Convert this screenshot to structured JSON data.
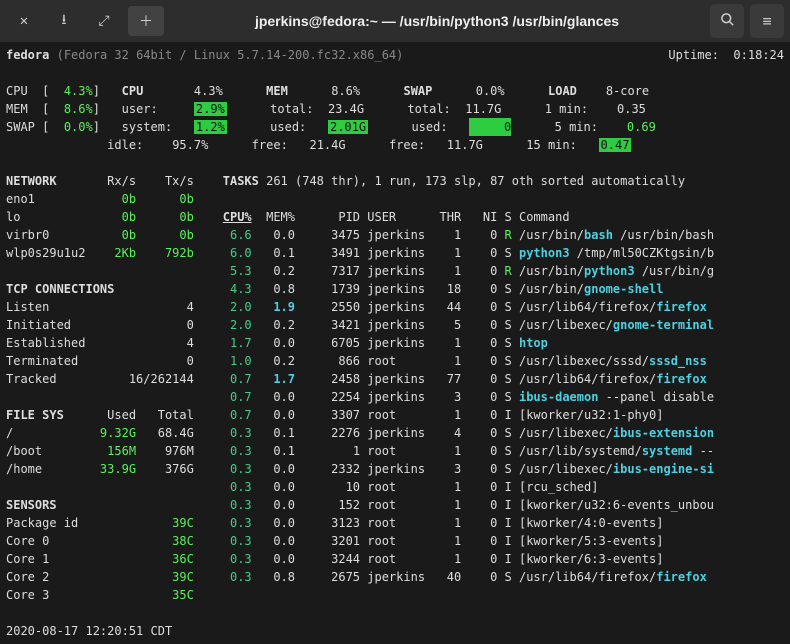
{
  "titlebar": {
    "title": "jperkins@fedora:~ — /usr/bin/python3 /usr/bin/glances"
  },
  "header": {
    "hostname": "fedora",
    "sysinfo": "(Fedora 32 64bit / Linux 5.7.14-200.fc32.x86_64)",
    "uptime_label": "Uptime:",
    "uptime": "0:18:24"
  },
  "summary": {
    "cpu_lbl": "CPU",
    "cpu_val": "4.3%",
    "mem_lbl": "MEM",
    "mem_val": "8.6%",
    "swap_lbl": "SWAP",
    "swap_val": "0.0%",
    "cpu2_lbl": "CPU",
    "cpu2_val": "4.3%",
    "user_lbl": "user:",
    "user_val": "2.9%",
    "system_lbl": "system:",
    "system_val": "1.2%",
    "idle_lbl": "idle:",
    "idle_val": "95.7%",
    "mem2_lbl": "MEM",
    "mem2_val": "8.6%",
    "total_lbl": "total:",
    "total_val": "23.4G",
    "used_lbl": "used:",
    "used_val": "2.01G",
    "free_lbl": "free:",
    "free_val": "21.4G",
    "swap2_lbl": "SWAP",
    "swap2_val": "0.0%",
    "swap_total_lbl": "total:",
    "swap_total_val": "11.7G",
    "swap_used_lbl": "used:",
    "swap_used_val": "0",
    "swap_free_lbl": "free:",
    "swap_free_val": "11.7G",
    "load_lbl": "LOAD",
    "load_val": "8-core",
    "load1_lbl": "1 min:",
    "load1_val": "0.35",
    "load5_lbl": "5 min:",
    "load5_val": "0.69",
    "load15_lbl": "15 min:",
    "load15_val": "0.47"
  },
  "network": {
    "title": "NETWORK",
    "col1": "Rx/s",
    "col2": "Tx/s",
    "rows": [
      {
        "n": "eno1",
        "r": "0b",
        "t": "0b"
      },
      {
        "n": "lo",
        "r": "0b",
        "t": "0b"
      },
      {
        "n": "virbr0",
        "r": "0b",
        "t": "0b"
      },
      {
        "n": "wlp0s29u1u2",
        "r": "2Kb",
        "t": "792b"
      }
    ]
  },
  "tcp": {
    "title": "TCP CONNECTIONS",
    "rows": [
      {
        "n": "Listen",
        "v": "4"
      },
      {
        "n": "Initiated",
        "v": "0"
      },
      {
        "n": "Established",
        "v": "4"
      },
      {
        "n": "Terminated",
        "v": "0"
      },
      {
        "n": "Tracked",
        "v": "16/262144"
      }
    ]
  },
  "fs": {
    "title": "FILE SYS",
    "col1": "Used",
    "col2": "Total",
    "rows": [
      {
        "n": "/",
        "u": "9.32G",
        "t": "68.4G",
        "uc": "green"
      },
      {
        "n": "/boot",
        "u": "156M",
        "t": "976M",
        "uc": "green"
      },
      {
        "n": "/home",
        "u": "33.9G",
        "t": "376G",
        "uc": "green"
      }
    ]
  },
  "sensors": {
    "title": "SENSORS",
    "rows": [
      {
        "n": "Package id",
        "v": "39C"
      },
      {
        "n": "Core 0",
        "v": "38C"
      },
      {
        "n": "Core 1",
        "v": "36C"
      },
      {
        "n": "Core 2",
        "v": "39C"
      },
      {
        "n": "Core 3",
        "v": "35C"
      }
    ]
  },
  "tasks": {
    "title": "TASKS",
    "summary": "261 (748 thr), 1 run, 173 slp, 87 oth sorted automatically",
    "headers": {
      "cpu": "CPU%",
      "mem": "MEM%",
      "pid": "PID",
      "user": "USER",
      "thr": "THR",
      "ni": "NI",
      "s": "S",
      "cmd": "Command"
    },
    "rows": [
      {
        "cpu": "6.6",
        "mem": "0.0",
        "pid": "3475",
        "user": "jperkins",
        "thr": "1",
        "ni": "0",
        "s": "R",
        "cmd": "/usr/bin/",
        "hi": "bash",
        "rest": " /usr/bin/bash"
      },
      {
        "cpu": "6.0",
        "mem": "0.1",
        "pid": "3491",
        "user": "jperkins",
        "thr": "1",
        "ni": "0",
        "s": "S",
        "cmd": "",
        "hi": "python3",
        "rest": " /tmp/ml50CZKtgsin/b"
      },
      {
        "cpu": "5.3",
        "mem": "0.2",
        "pid": "7317",
        "user": "jperkins",
        "thr": "1",
        "ni": "0",
        "s": "R",
        "cmd": "/usr/bin/",
        "hi": "python3",
        "rest": " /usr/bin/g"
      },
      {
        "cpu": "4.3",
        "mem": "0.8",
        "pid": "1739",
        "user": "jperkins",
        "thr": "18",
        "ni": "0",
        "s": "S",
        "cmd": "/usr/bin/",
        "hi": "gnome-shell",
        "rest": ""
      },
      {
        "cpu": "2.0",
        "mem": "1.9",
        "memhi": true,
        "pid": "2550",
        "user": "jperkins",
        "thr": "44",
        "ni": "0",
        "s": "S",
        "cmd": "/usr/lib64/firefox/",
        "hi": "firefox",
        "rest": ""
      },
      {
        "cpu": "2.0",
        "mem": "0.2",
        "pid": "3421",
        "user": "jperkins",
        "thr": "5",
        "ni": "0",
        "s": "S",
        "cmd": "/usr/libexec/",
        "hi": "gnome-terminal",
        "rest": ""
      },
      {
        "cpu": "1.7",
        "mem": "0.0",
        "pid": "6705",
        "user": "jperkins",
        "thr": "1",
        "ni": "0",
        "s": "S",
        "cmd": "",
        "hi": "htop",
        "rest": ""
      },
      {
        "cpu": "1.0",
        "mem": "0.2",
        "pid": "866",
        "user": "root",
        "thr": "1",
        "ni": "0",
        "s": "S",
        "cmd": "/usr/libexec/sssd/",
        "hi": "sssd_nss",
        "rest": ""
      },
      {
        "cpu": "0.7",
        "mem": "1.7",
        "memhi": true,
        "pid": "2458",
        "user": "jperkins",
        "thr": "77",
        "ni": "0",
        "s": "S",
        "cmd": "/usr/lib64/firefox/",
        "hi": "firefox",
        "rest": ""
      },
      {
        "cpu": "0.7",
        "mem": "0.0",
        "pid": "2254",
        "user": "jperkins",
        "thr": "3",
        "ni": "0",
        "s": "S",
        "cmd": "",
        "hi": "ibus-daemon",
        "rest": " --panel disable"
      },
      {
        "cpu": "0.7",
        "mem": "0.0",
        "pid": "3307",
        "user": "root",
        "thr": "1",
        "ni": "0",
        "s": "I",
        "cmd": "[kworker/u32:1-phy0]",
        "hi": "",
        "rest": ""
      },
      {
        "cpu": "0.3",
        "mem": "0.1",
        "pid": "2276",
        "user": "jperkins",
        "thr": "4",
        "ni": "0",
        "s": "S",
        "cmd": "/usr/libexec/",
        "hi": "ibus-extension",
        "rest": ""
      },
      {
        "cpu": "0.3",
        "mem": "0.1",
        "pid": "1",
        "user": "root",
        "thr": "1",
        "ni": "0",
        "s": "S",
        "cmd": "/usr/lib/systemd/",
        "hi": "systemd",
        "rest": " --"
      },
      {
        "cpu": "0.3",
        "mem": "0.0",
        "pid": "2332",
        "user": "jperkins",
        "thr": "3",
        "ni": "0",
        "s": "S",
        "cmd": "/usr/libexec/",
        "hi": "ibus-engine-si",
        "rest": ""
      },
      {
        "cpu": "0.3",
        "mem": "0.0",
        "pid": "10",
        "user": "root",
        "thr": "1",
        "ni": "0",
        "s": "I",
        "cmd": "[rcu_sched]",
        "hi": "",
        "rest": ""
      },
      {
        "cpu": "0.3",
        "mem": "0.0",
        "pid": "152",
        "user": "root",
        "thr": "1",
        "ni": "0",
        "s": "I",
        "cmd": "[kworker/u32:6-events_unbou",
        "hi": "",
        "rest": ""
      },
      {
        "cpu": "0.3",
        "mem": "0.0",
        "pid": "3123",
        "user": "root",
        "thr": "1",
        "ni": "0",
        "s": "I",
        "cmd": "[kworker/4:0-events]",
        "hi": "",
        "rest": ""
      },
      {
        "cpu": "0.3",
        "mem": "0.0",
        "pid": "3201",
        "user": "root",
        "thr": "1",
        "ni": "0",
        "s": "I",
        "cmd": "[kworker/5:3-events]",
        "hi": "",
        "rest": ""
      },
      {
        "cpu": "0.3",
        "mem": "0.0",
        "pid": "3244",
        "user": "root",
        "thr": "1",
        "ni": "0",
        "s": "I",
        "cmd": "[kworker/6:3-events]",
        "hi": "",
        "rest": ""
      },
      {
        "cpu": "0.3",
        "mem": "0.8",
        "pid": "2675",
        "user": "jperkins",
        "thr": "40",
        "ni": "0",
        "s": "S",
        "cmd": "/usr/lib64/firefox/",
        "hi": "firefox",
        "rest": ""
      }
    ]
  },
  "footer": "2020-08-17 12:20:51 CDT"
}
